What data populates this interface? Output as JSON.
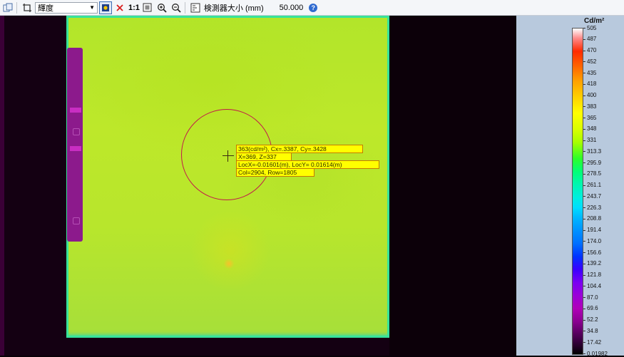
{
  "toolbar": {
    "mode_select_value": "輝度",
    "scale_label": "1:1",
    "detector_size_label": "検測器大小 (mm)",
    "detector_size_value": "50.000"
  },
  "overlay": {
    "info_lines": [
      "363(cd/m²), Cx=.3387, Cy=.3428",
      "X=369, Z=337",
      "LocX=-0.01601(m), LocY= 0.01614(m)",
      "Col=2904, Row=1805"
    ]
  },
  "scale": {
    "unit": "Cd/m²",
    "labels": [
      "505",
      "487",
      "470",
      "452",
      "435",
      "418",
      "400",
      "383",
      "365",
      "348",
      "331",
      "313.3",
      "295.9",
      "278.5",
      "261.1",
      "243.7",
      "226.3",
      "208.8",
      "191.4",
      "174.0",
      "156.6",
      "139.2",
      "121.8",
      "104.4",
      "87.0",
      "69.6",
      "52.2",
      "34.8",
      "17.42",
      "0.01982"
    ]
  },
  "colors": {
    "toolbar_bg": "#f4f6f9",
    "scale_panel_bg": "#b8c9dd",
    "overlay_box": "#ffff00",
    "circle": "#c2184a"
  },
  "icons": [
    "copy-icon",
    "crop-icon",
    "target-icon",
    "close-icon",
    "fit-icon",
    "zoom-in-icon",
    "zoom-out-icon",
    "detector-icon",
    "help-icon"
  ]
}
